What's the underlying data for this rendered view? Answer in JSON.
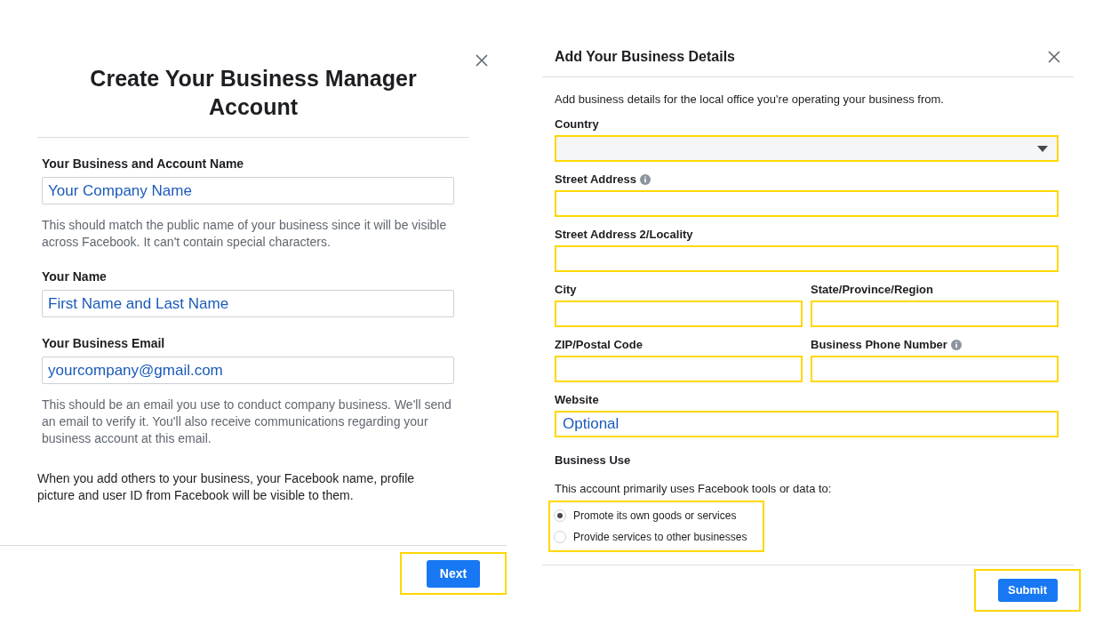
{
  "create_dialog": {
    "title": "Create Your Business Manager Account",
    "fields": [
      {
        "label": "Your Business and Account Name",
        "value": "Your Company Name",
        "help": "This should match the public name of your business since it will be visible across Facebook. It can't contain special characters."
      },
      {
        "label": "Your Name",
        "value": "First Name and Last Name"
      },
      {
        "label": "Your Business Email",
        "value": "yourcompany@gmail.com",
        "help": "This should be an email you use to conduct company business. We'll send an email to verify it. You'll also receive communications regarding your business account at this email."
      }
    ],
    "note": "When you add others to your business, your Facebook name, profile picture and user ID from Facebook will be visible to them.",
    "button": {
      "label": "Next",
      "highlighted": true
    }
  },
  "details_dialog": {
    "title": "Add Your Business Details",
    "description": "Add business details for the local office you're operating your business from.",
    "rows": [
      [
        {
          "label": "Country",
          "kind": "select",
          "info": false,
          "highlighted": true
        }
      ],
      [
        {
          "label": "Street Address",
          "kind": "text",
          "info": true,
          "highlighted": true
        }
      ],
      [
        {
          "label": "Street Address 2/Locality",
          "kind": "text",
          "info": false,
          "highlighted": true
        }
      ],
      [
        {
          "label": "City",
          "kind": "text",
          "info": false,
          "highlighted": true
        },
        {
          "label": "State/Province/Region",
          "kind": "text",
          "info": false,
          "highlighted": true
        }
      ],
      [
        {
          "label": "ZIP/Postal Code",
          "kind": "text",
          "info": false,
          "highlighted": true
        },
        {
          "label": "Business Phone Number",
          "kind": "text",
          "info": true,
          "highlighted": true
        }
      ],
      [
        {
          "label": "Website",
          "kind": "text",
          "placeholder": "Optional",
          "info": false,
          "highlighted": true
        }
      ]
    ],
    "business_use": {
      "heading": "Business Use",
      "question": "This account primarily uses Facebook tools or data to:",
      "highlighted": true,
      "options": [
        {
          "label": "Promote its own goods or services",
          "selected": true
        },
        {
          "label": "Provide services to other businesses",
          "selected": false
        }
      ]
    },
    "button": {
      "label": "Submit",
      "highlighted": true
    }
  }
}
